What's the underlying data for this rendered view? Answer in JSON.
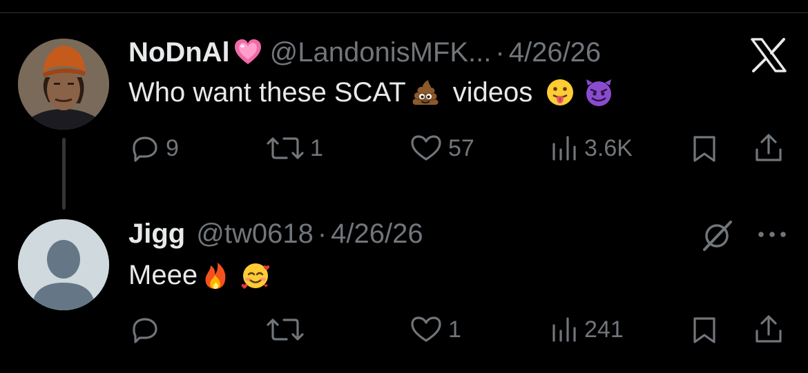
{
  "tweet1": {
    "display_name": "NoDnAl",
    "handle": "@LandonisMFK...",
    "separator": "·",
    "date": "4/26/26",
    "text_before": "Who want these SCAT",
    "text_after": "videos",
    "emojis": [
      "pink-heart",
      "pile-of-poo",
      "face-with-tongue",
      "smiling-face-with-horns"
    ],
    "replies": "9",
    "reposts": "1",
    "likes": "57",
    "views": "3.6K",
    "platform_logo": "x-logo"
  },
  "tweet2": {
    "display_name": "Jigg",
    "handle": "@tw0618",
    "separator": "·",
    "date": "4/26/26",
    "text": "Meee",
    "emojis": [
      "fire",
      "smiling-face-with-hearts"
    ],
    "replies": "",
    "reposts": "",
    "likes": "1",
    "views": "241"
  },
  "colors": {
    "background": "#000000",
    "primary_text": "#e7e9ea",
    "secondary_text": "#71767b",
    "divider": "#2f3336"
  }
}
